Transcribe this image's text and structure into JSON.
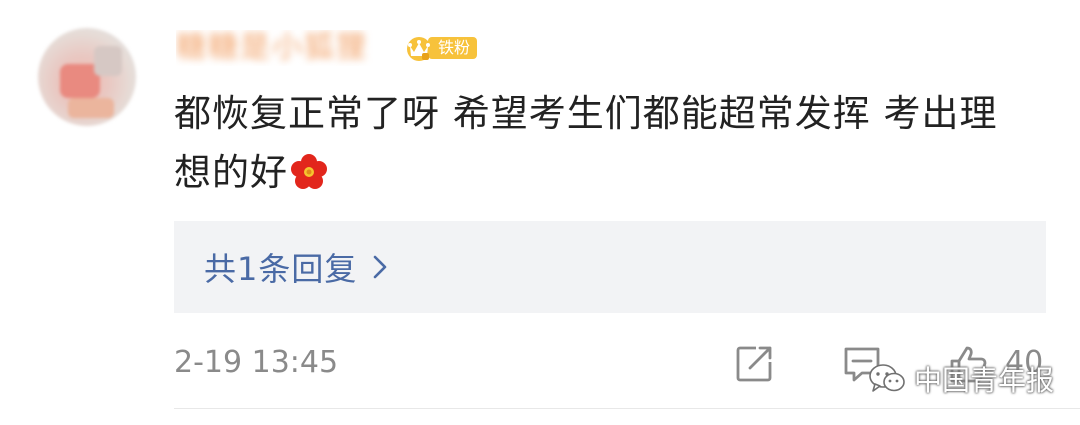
{
  "user": {
    "username": "糖糖是小狐狸",
    "badge_label": "铁粉"
  },
  "comment": {
    "text": "都恢复正常了呀 希望考生们都能超常发挥 考出理想的好",
    "emoji": "flower-emoji"
  },
  "replies": {
    "label": "共1条回复"
  },
  "footer": {
    "timestamp": "2-19 13:45",
    "like_count": "40"
  },
  "watermark": {
    "text": "中国青年报"
  },
  "colors": {
    "username": "#f2a36a",
    "badge": "#f7c23b",
    "reply_link": "#4a6aa5",
    "meta_text": "#8a8a8a",
    "reply_bg": "#f2f3f5"
  },
  "icons": [
    "share-icon",
    "comment-icon",
    "like-icon",
    "chevron-right-icon",
    "crown-icon",
    "wechat-icon"
  ]
}
